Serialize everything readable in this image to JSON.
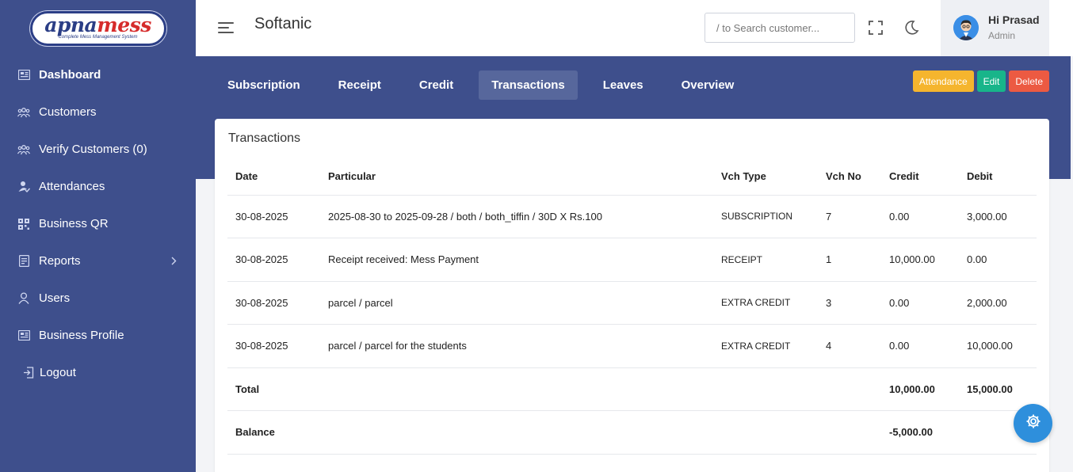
{
  "logo": {
    "text_a": "apna",
    "text_b": "mess",
    "subtitle": "Complete Mess Management System"
  },
  "sidebar": {
    "items": [
      {
        "label": "Dashboard",
        "icon": "dashboard-icon"
      },
      {
        "label": "Customers",
        "icon": "users-group-icon"
      },
      {
        "label": "Verify Customers (0)",
        "icon": "users-group-icon"
      },
      {
        "label": "Attendances",
        "icon": "user-check-icon"
      },
      {
        "label": "Business QR",
        "icon": "qr-icon"
      },
      {
        "label": "Reports",
        "icon": "report-icon"
      },
      {
        "label": "Users",
        "icon": "user-icon"
      },
      {
        "label": "Business Profile",
        "icon": "profile-card-icon"
      },
      {
        "label": "Logout",
        "icon": "logout-icon"
      }
    ]
  },
  "header": {
    "brand": "Softanic",
    "search_placeholder": "/ to Search customer...",
    "user_name": "Hi Prasad",
    "user_role": "Admin"
  },
  "tabs": [
    "Subscription",
    "Receipt",
    "Credit",
    "Transactions",
    "Leaves",
    "Overview"
  ],
  "actions": {
    "attendance": "Attendance",
    "edit": "Edit",
    "delete": "Delete"
  },
  "card": {
    "title": "Transactions",
    "columns": [
      "Date",
      "Particular",
      "Vch Type",
      "Vch No",
      "Credit",
      "Debit"
    ],
    "rows": [
      [
        "30-08-2025",
        "2025-08-30 to 2025-09-28 / both / both_tiffin / 30D X Rs.100",
        "SUBSCRIPTION",
        "7",
        "0.00",
        "3,000.00"
      ],
      [
        "30-08-2025",
        "Receipt received: Mess Payment",
        "RECEIPT",
        "1",
        "10,000.00",
        "0.00"
      ],
      [
        "30-08-2025",
        "parcel / parcel",
        "EXTRA CREDIT",
        "3",
        "0.00",
        "2,000.00"
      ],
      [
        "30-08-2025",
        "parcel / parcel for the students",
        "EXTRA CREDIT",
        "4",
        "0.00",
        "10,000.00"
      ]
    ],
    "total": {
      "label": "Total",
      "credit": "10,000.00",
      "debit": "15,000.00"
    },
    "balance": {
      "label": "Balance",
      "value": "-5,000.00"
    }
  },
  "colors": {
    "sidebar": "#3e4f8c",
    "accent": "#2e8fdc",
    "attendance": "#f5b52e",
    "edit": "#18b58a",
    "delete": "#ec5a42"
  }
}
